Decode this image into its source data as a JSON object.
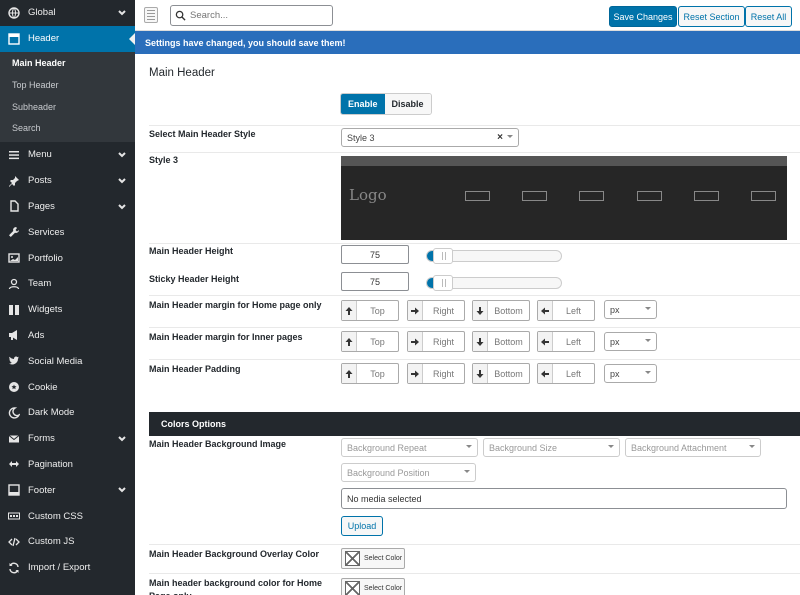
{
  "sidebar": {
    "items": [
      {
        "label": "Global",
        "icon": "globe-icon",
        "chevron": true
      },
      {
        "label": "Header",
        "icon": "header-icon",
        "chevron": false,
        "active": true
      },
      {
        "label": "Menu",
        "icon": "menu-icon",
        "chevron": true
      },
      {
        "label": "Posts",
        "icon": "pin-icon",
        "chevron": true
      },
      {
        "label": "Pages",
        "icon": "page-icon",
        "chevron": true
      },
      {
        "label": "Services",
        "icon": "wrench-icon",
        "chevron": false
      },
      {
        "label": "Portfolio",
        "icon": "portfolio-icon",
        "chevron": false
      },
      {
        "label": "Team",
        "icon": "person-icon",
        "chevron": false
      },
      {
        "label": "Widgets",
        "icon": "widgets-icon",
        "chevron": false
      },
      {
        "label": "Ads",
        "icon": "megaphone-icon",
        "chevron": false
      },
      {
        "label": "Social Media",
        "icon": "twitter-icon",
        "chevron": false
      },
      {
        "label": "Cookie",
        "icon": "cookie-icon",
        "chevron": false
      },
      {
        "label": "Dark Mode",
        "icon": "moon-icon",
        "chevron": false
      },
      {
        "label": "Forms",
        "icon": "mail-icon",
        "chevron": true
      },
      {
        "label": "Pagination",
        "icon": "arrows-icon",
        "chevron": false
      },
      {
        "label": "Footer",
        "icon": "footer-icon",
        "chevron": true
      },
      {
        "label": "Custom CSS",
        "icon": "css-icon",
        "chevron": false
      },
      {
        "label": "Custom JS",
        "icon": "code-icon",
        "chevron": false
      },
      {
        "label": "Import / Export",
        "icon": "sync-icon",
        "chevron": false
      }
    ],
    "submenu": [
      "Main Header",
      "Top Header",
      "Subheader",
      "Search"
    ]
  },
  "topbar": {
    "search_placeholder": "Search...",
    "save_label": "Save Changes",
    "reset_section_label": "Reset Section",
    "reset_all_label": "Reset All"
  },
  "notice": "Settings have changed, you should save them!",
  "main": {
    "title": "Main Header",
    "toggle": {
      "enable": "Enable",
      "disable": "Disable"
    },
    "style_label": "Select Main Header Style",
    "style_value": "Style 3",
    "style_preview_label": "Style 3",
    "preview_logo": "Logo",
    "height_label": "Main Header Height",
    "height_value": "75",
    "height_slider_percent": 12,
    "sticky_label": "Sticky Header Height",
    "sticky_value": "75",
    "sticky_slider_percent": 12,
    "margin_home_label": "Main Header margin for Home page only",
    "margin_inner_label": "Main Header margin for Inner pages",
    "padding_label": "Main Header Padding",
    "dims": {
      "top": "Top",
      "right": "Right",
      "bottom": "Bottom",
      "left": "Left",
      "unit": "px"
    },
    "colors_title": "Colors Options",
    "bg_image_label": "Main Header Background Image",
    "bg_repeat": "Background Repeat",
    "bg_size": "Background Size",
    "bg_attachment": "Background Attachment",
    "bg_position": "Background Position",
    "media_value": "No media selected",
    "upload_label": "Upload",
    "overlay_label": "Main Header Background Overlay Color",
    "select_color": "Select Color",
    "home_bg_label": "Main header background color for Home Page only"
  },
  "colors": {
    "accent": "#0073aa",
    "sidebar": "#23282d",
    "notice": "#2a6ebb"
  }
}
